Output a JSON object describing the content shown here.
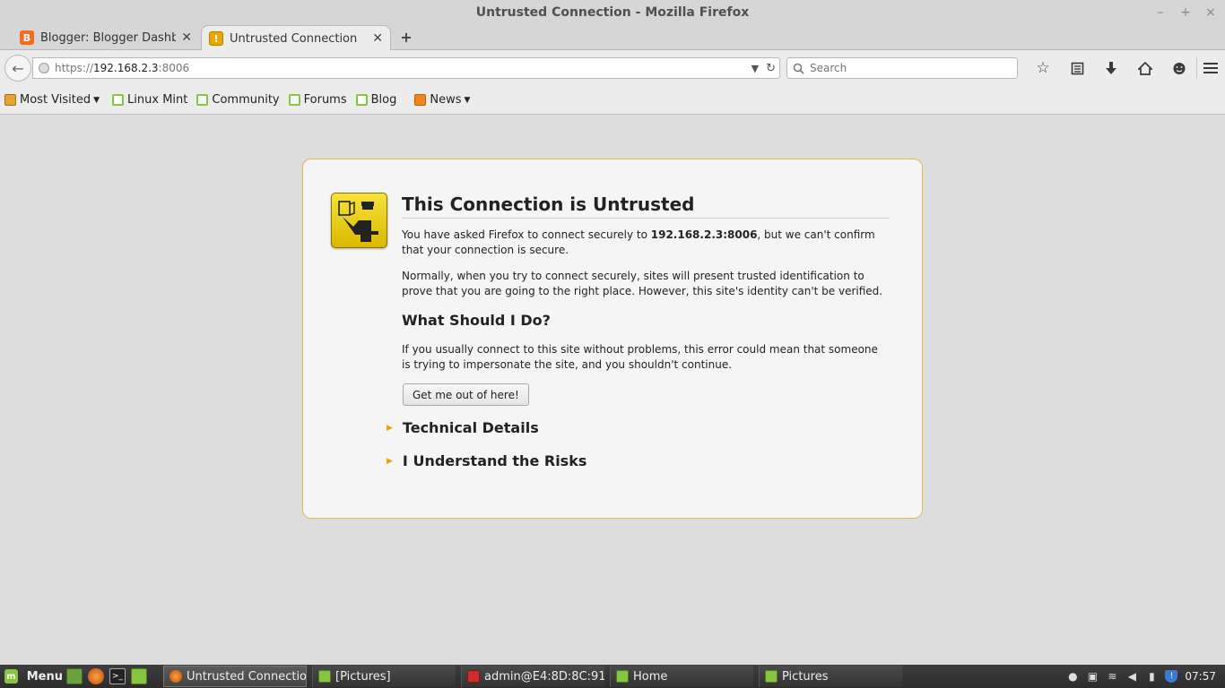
{
  "window": {
    "title": "Untrusted Connection - Mozilla Firefox"
  },
  "tabs": [
    {
      "label": "Blogger: Blogger Dashbo...",
      "favicon": "blogger-icon"
    },
    {
      "label": "Untrusted Connection",
      "favicon": "warning-icon"
    }
  ],
  "urlbar": {
    "scheme": "https://",
    "host": "192.168.2.3",
    "port": ":8006"
  },
  "search": {
    "placeholder": "Search"
  },
  "bookmarks": [
    {
      "label": "Most Visited",
      "icon": "folder-icon",
      "dropdown": true
    },
    {
      "label": "Linux Mint",
      "icon": "mint-icon"
    },
    {
      "label": "Community",
      "icon": "mint-icon"
    },
    {
      "label": "Forums",
      "icon": "mint-icon"
    },
    {
      "label": "Blog",
      "icon": "mint-icon"
    },
    {
      "label": "News",
      "icon": "rss-icon",
      "dropdown": true
    }
  ],
  "error": {
    "title": "This Connection is Untrusted",
    "p1_pre": "You have asked Firefox to connect securely to ",
    "p1_host": "192.168.2.3:8006",
    "p1_post": ", but we can't confirm that your connection is secure.",
    "p2": "Normally, when you try to connect securely, sites will present trusted identification to prove that you are going to the right place. However, this site's identity can't be verified.",
    "what_heading": "What Should I Do?",
    "p3": "If you usually connect to this site without problems, this error could mean that someone is trying to impersonate the site, and you shouldn't continue.",
    "button": "Get me out of here!",
    "technical": "Technical Details",
    "risks": "I Understand the Risks"
  },
  "taskbar": {
    "menu_label": "Menu",
    "tasks": [
      {
        "label": "Untrusted Connectio...",
        "icon": "firefox-icon"
      },
      {
        "label": "[Pictures]",
        "icon": "folder-icon"
      },
      {
        "label": "admin@E4:8D:8C:91....",
        "icon": "terminal-icon"
      },
      {
        "label": "Home",
        "icon": "folder-icon"
      },
      {
        "label": "Pictures",
        "icon": "folder-icon"
      }
    ],
    "clock": "07:57"
  },
  "colors": {
    "accent_border": "#e6b94e",
    "warning_yellow": "#e6a700",
    "taskbar_bg": "#333333"
  }
}
